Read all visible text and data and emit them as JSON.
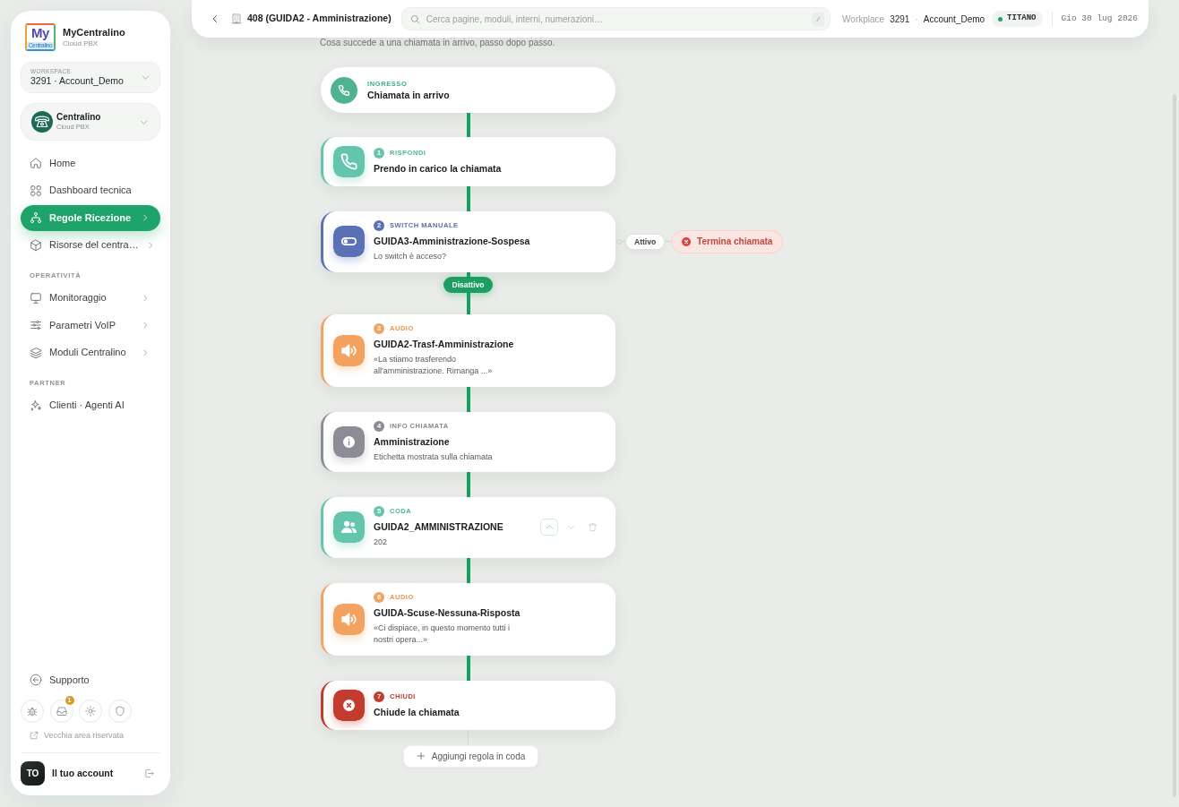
{
  "sidebar": {
    "brand": {
      "logo_text": "My",
      "logo_caption": "Centralino",
      "name": "MyCentralino",
      "subtitle": "Cloud PBX"
    },
    "workspace": {
      "label": "WORKSPACE",
      "value": "3291 · Account_Demo"
    },
    "service": {
      "name": "Centralino",
      "subtitle": "Cloud PBX"
    },
    "sections": [
      {
        "items": [
          {
            "kind": "home",
            "label": "Home",
            "selected": false,
            "has_submenu": false
          },
          {
            "kind": "dashboard",
            "label": "Dashboard tecnica",
            "selected": false,
            "has_submenu": false
          },
          {
            "kind": "rules",
            "label": "Regole Ricezione",
            "selected": true,
            "has_submenu": true
          },
          {
            "kind": "resources",
            "label": "Risorse del centra…",
            "selected": false,
            "has_submenu": true
          }
        ]
      },
      {
        "title": "OPERATIVITÀ",
        "items": [
          {
            "kind": "monitoring",
            "label": "Monitoraggio",
            "selected": false,
            "has_submenu": true
          },
          {
            "kind": "settings",
            "label": "Parametri VoIP",
            "selected": false,
            "has_submenu": true
          },
          {
            "kind": "modules",
            "label": "Moduli Centralino",
            "selected": false,
            "has_submenu": true
          }
        ]
      },
      {
        "title": "PARTNER",
        "items": [
          {
            "kind": "clients",
            "label": "Clienti · Agenti AI",
            "selected": false,
            "has_submenu": false
          }
        ]
      }
    ],
    "support": {
      "label": "Supporto"
    },
    "quick_actions": [
      {
        "kind": "bug"
      },
      {
        "kind": "inbox",
        "badge": "1"
      },
      {
        "kind": "theme"
      },
      {
        "kind": "privacy"
      }
    ],
    "legacy_link": "Vecchia area riservata",
    "account": {
      "initials": "TO",
      "label": "Il tuo account"
    }
  },
  "top_bar": {
    "page_title": "408 (GUIDA2 - Amministrazione)",
    "search": {
      "placeholder": "Cerca pagine, moduli, interni, numerazioni…",
      "shortcut": "/"
    },
    "workspace_caption": "Workplace",
    "workspace_id": "3291",
    "separator": "·",
    "workspace_name": "Account_Demo",
    "plan": "TITANO",
    "date": "Gio 30 lug 2026"
  },
  "page_subtitle": "Cosa succede a una chiamata in arrivo, passo dopo passo.",
  "flow": {
    "entry": {
      "label": "INGRESSO",
      "title": "Chiamata in arrivo"
    },
    "steps": [
      {
        "kind": "answer",
        "number": "1",
        "label": "RISPONDI",
        "title": "Prendo in carico la chiamata"
      },
      {
        "kind": "switch",
        "number": "2",
        "label": "SWITCH MANUALE",
        "title": "GUIDA3-Amministrazione-Sospesa",
        "description": "Lo switch è acceso?",
        "branch": {
          "label": "Attivo",
          "target": "Termina chiamata"
        },
        "else_label": "Disattivo"
      },
      {
        "kind": "audio",
        "number": "3",
        "label": "AUDIO",
        "title": "GUIDA2-Trasf-Amministrazione",
        "description": "«La stiamo trasferendo all'amministrazione. Rimanga ...»"
      },
      {
        "kind": "info",
        "number": "4",
        "label": "INFO CHIAMATA",
        "title": "Amministrazione",
        "description": "Etichetta mostrata sulla chiamata"
      },
      {
        "kind": "queue",
        "number": "5",
        "label": "CODA",
        "title": "GUIDA2_AMMINISTRAZIONE",
        "description": "202",
        "actions": [
          {
            "kind": "up",
            "focused": true
          },
          {
            "kind": "down",
            "focused": false
          },
          {
            "kind": "delete",
            "focused": false
          }
        ]
      },
      {
        "kind": "audio",
        "number": "6",
        "label": "AUDIO",
        "title": "GUIDA-Scuse-Nessuna-Risposta",
        "description": "«Ci dispiace, in questo momento tutti i nostri opera...»"
      },
      {
        "kind": "hangup",
        "number": "7",
        "label": "CHIUDI",
        "title": "Chiude la chiamata"
      }
    ],
    "add_button": "Aggiungi regola in coda"
  }
}
